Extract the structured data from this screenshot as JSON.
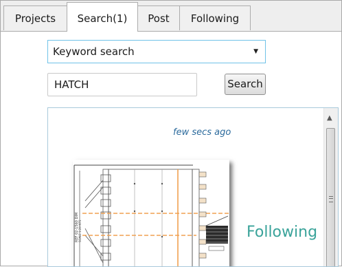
{
  "tabs": [
    {
      "label": "Projects",
      "active": false
    },
    {
      "label": "Search(1)",
      "active": true
    },
    {
      "label": "Post",
      "active": false
    },
    {
      "label": "Following",
      "active": false
    }
  ],
  "search": {
    "mode_selected": "Keyword search",
    "keyword_value": "HATCH",
    "button_label": "Search"
  },
  "result": {
    "timestamp": "few secs ago",
    "status": "Following"
  },
  "colors": {
    "accent_border": "#6fc2e8",
    "timestamp": "#2b6a9c",
    "status": "#3aa39a",
    "drawing_highlight": "#f0a050"
  },
  "icons": {
    "dropdown": "caret-down-icon",
    "scroll_up": "scroll-up-arrow-icon",
    "grip": "scroll-grip-icon"
  }
}
